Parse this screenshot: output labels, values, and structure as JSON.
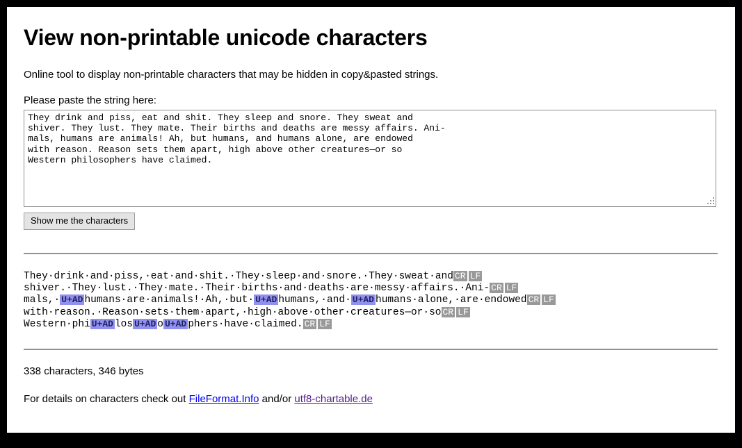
{
  "page": {
    "title": "View non-printable unicode characters",
    "intro": "Online tool to display non-printable characters that may be hidden in copy&pasted strings.",
    "paste_label": "Please paste the string here:"
  },
  "form": {
    "textarea_value": "They drink and piss, eat and shit. They sleep and snore. They sweat and\nshiver. They lust. They mate. Their births and deaths are messy affairs. Ani-\nmals, humans are animals! Ah, but humans, and humans alone, are endowed\nwith reason. Reason sets them apart, high above other creatures—or so\nWestern philosophers have claimed.",
    "textarea_placeholder": "",
    "submit_label": "Show me the characters",
    "resize_grip_icon": "resize-grip-icon"
  },
  "output": {
    "space_glyph": "·",
    "lines": [
      [
        {
          "t": "text",
          "v": "They"
        },
        {
          "t": "space"
        },
        {
          "t": "text",
          "v": "drink"
        },
        {
          "t": "space"
        },
        {
          "t": "text",
          "v": "and"
        },
        {
          "t": "space"
        },
        {
          "t": "text",
          "v": "piss,"
        },
        {
          "t": "space"
        },
        {
          "t": "text",
          "v": "eat"
        },
        {
          "t": "space"
        },
        {
          "t": "text",
          "v": "and"
        },
        {
          "t": "space"
        },
        {
          "t": "text",
          "v": "shit."
        },
        {
          "t": "space"
        },
        {
          "t": "text",
          "v": "They"
        },
        {
          "t": "space"
        },
        {
          "t": "text",
          "v": "sleep"
        },
        {
          "t": "space"
        },
        {
          "t": "text",
          "v": "and"
        },
        {
          "t": "space"
        },
        {
          "t": "text",
          "v": "snore."
        },
        {
          "t": "space"
        },
        {
          "t": "text",
          "v": "They"
        },
        {
          "t": "space"
        },
        {
          "t": "text",
          "v": "sweat"
        },
        {
          "t": "space"
        },
        {
          "t": "text",
          "v": "and"
        },
        {
          "t": "ctrl",
          "v": "CR"
        },
        {
          "t": "ctrl",
          "v": "LF"
        }
      ],
      [
        {
          "t": "text",
          "v": "shiver."
        },
        {
          "t": "space"
        },
        {
          "t": "text",
          "v": "They"
        },
        {
          "t": "space"
        },
        {
          "t": "text",
          "v": "lust."
        },
        {
          "t": "space"
        },
        {
          "t": "text",
          "v": "They"
        },
        {
          "t": "space"
        },
        {
          "t": "text",
          "v": "mate."
        },
        {
          "t": "space"
        },
        {
          "t": "text",
          "v": "Their"
        },
        {
          "t": "space"
        },
        {
          "t": "text",
          "v": "births"
        },
        {
          "t": "space"
        },
        {
          "t": "text",
          "v": "and"
        },
        {
          "t": "space"
        },
        {
          "t": "text",
          "v": "deaths"
        },
        {
          "t": "space"
        },
        {
          "t": "text",
          "v": "are"
        },
        {
          "t": "space"
        },
        {
          "t": "text",
          "v": "messy"
        },
        {
          "t": "space"
        },
        {
          "t": "text",
          "v": "affairs."
        },
        {
          "t": "space"
        },
        {
          "t": "text",
          "v": "Ani-"
        },
        {
          "t": "ctrl",
          "v": "CR"
        },
        {
          "t": "ctrl",
          "v": "LF"
        }
      ],
      [
        {
          "t": "text",
          "v": "mals,"
        },
        {
          "t": "space"
        },
        {
          "t": "uni",
          "v": "U+AD"
        },
        {
          "t": "text",
          "v": "humans"
        },
        {
          "t": "space"
        },
        {
          "t": "text",
          "v": "are"
        },
        {
          "t": "space"
        },
        {
          "t": "text",
          "v": "animals!"
        },
        {
          "t": "space"
        },
        {
          "t": "text",
          "v": "Ah,"
        },
        {
          "t": "space"
        },
        {
          "t": "text",
          "v": "but"
        },
        {
          "t": "space"
        },
        {
          "t": "uni",
          "v": "U+AD"
        },
        {
          "t": "text",
          "v": "humans,"
        },
        {
          "t": "space"
        },
        {
          "t": "text",
          "v": "and"
        },
        {
          "t": "space"
        },
        {
          "t": "uni",
          "v": "U+AD"
        },
        {
          "t": "text",
          "v": "humans"
        },
        {
          "t": "space"
        },
        {
          "t": "text",
          "v": "alone,"
        },
        {
          "t": "space"
        },
        {
          "t": "text",
          "v": "are"
        },
        {
          "t": "space"
        },
        {
          "t": "text",
          "v": "endowed"
        },
        {
          "t": "ctrl",
          "v": "CR"
        },
        {
          "t": "ctrl",
          "v": "LF"
        }
      ],
      [
        {
          "t": "text",
          "v": "with"
        },
        {
          "t": "space"
        },
        {
          "t": "text",
          "v": "reason."
        },
        {
          "t": "space"
        },
        {
          "t": "text",
          "v": "Reason"
        },
        {
          "t": "space"
        },
        {
          "t": "text",
          "v": "sets"
        },
        {
          "t": "space"
        },
        {
          "t": "text",
          "v": "them"
        },
        {
          "t": "space"
        },
        {
          "t": "text",
          "v": "apart,"
        },
        {
          "t": "space"
        },
        {
          "t": "text",
          "v": "high"
        },
        {
          "t": "space"
        },
        {
          "t": "text",
          "v": "above"
        },
        {
          "t": "space"
        },
        {
          "t": "text",
          "v": "other"
        },
        {
          "t": "space"
        },
        {
          "t": "text",
          "v": "creatures—or"
        },
        {
          "t": "space"
        },
        {
          "t": "text",
          "v": "so"
        },
        {
          "t": "ctrl",
          "v": "CR"
        },
        {
          "t": "ctrl",
          "v": "LF"
        }
      ],
      [
        {
          "t": "text",
          "v": "Western"
        },
        {
          "t": "space"
        },
        {
          "t": "text",
          "v": "phi"
        },
        {
          "t": "uni",
          "v": "U+AD"
        },
        {
          "t": "text",
          "v": "los"
        },
        {
          "t": "uni",
          "v": "U+AD"
        },
        {
          "t": "text",
          "v": "o"
        },
        {
          "t": "uni",
          "v": "U+AD"
        },
        {
          "t": "text",
          "v": "phers"
        },
        {
          "t": "space"
        },
        {
          "t": "text",
          "v": "have"
        },
        {
          "t": "space"
        },
        {
          "t": "text",
          "v": "claimed."
        },
        {
          "t": "ctrl",
          "v": "CR"
        },
        {
          "t": "ctrl",
          "v": "LF"
        }
      ]
    ]
  },
  "footer": {
    "counts": "338 characters, 346 bytes",
    "details_prefix": "For details on characters check out ",
    "link1": "FileFormat.Info",
    "details_middle": " and/or ",
    "link2": "utf8-chartable.de"
  },
  "colors": {
    "control_badge_bg": "#999999",
    "control_badge_fg": "#ffffff",
    "unicode_badge_bg": "#9090ee",
    "unicode_badge_fg": "#202060",
    "link_unvisited": "#0000ee",
    "link_visited": "#551a8b",
    "page_border": "#000000",
    "rule": "#919191"
  }
}
